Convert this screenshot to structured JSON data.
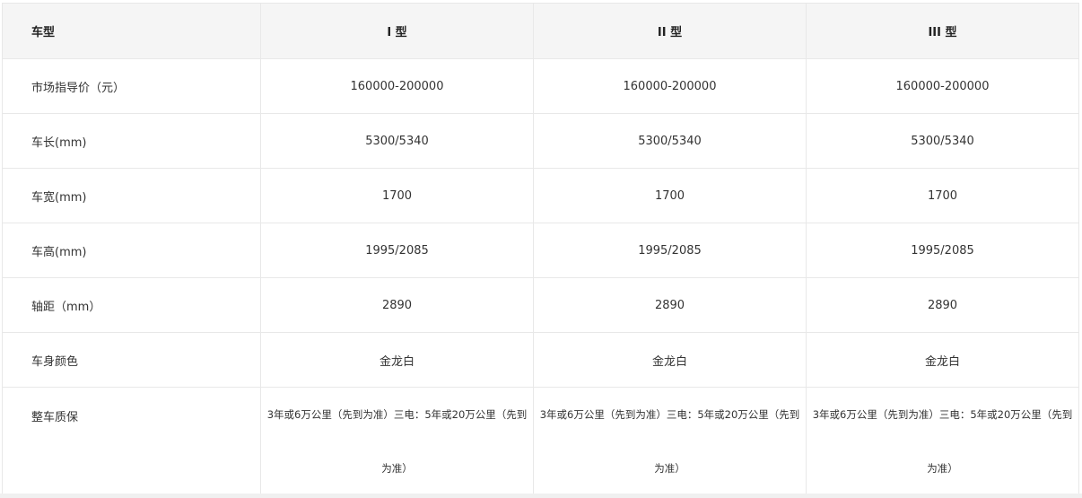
{
  "table": {
    "headers": [
      "车型",
      "I 型",
      "II 型",
      "III 型"
    ],
    "rows": [
      {
        "label": "市场指导价（元）",
        "values": [
          "160000-200000",
          "160000-200000",
          "160000-200000"
        ]
      },
      {
        "label": "车长(mm)",
        "values": [
          "5300/5340",
          "5300/5340",
          "5300/5340"
        ]
      },
      {
        "label": "车宽(mm)",
        "values": [
          "1700",
          "1700",
          "1700"
        ]
      },
      {
        "label": "车高(mm)",
        "values": [
          "1995/2085",
          "1995/2085",
          "1995/2085"
        ]
      },
      {
        "label": "轴距（mm）",
        "values": [
          "2890",
          "2890",
          "2890"
        ]
      },
      {
        "label": "车身颜色",
        "values": [
          "金龙白",
          "金龙白",
          "金龙白"
        ]
      },
      {
        "label": "整车质保",
        "values": [
          "3年或6万公里（先到为准）三电：5年或20万公里（先到为准）",
          "3年或6万公里（先到为准）三电：5年或20万公里（先到为准）",
          "3年或6万公里（先到为准）三电：5年或20万公里（先到为准）"
        ]
      }
    ]
  }
}
